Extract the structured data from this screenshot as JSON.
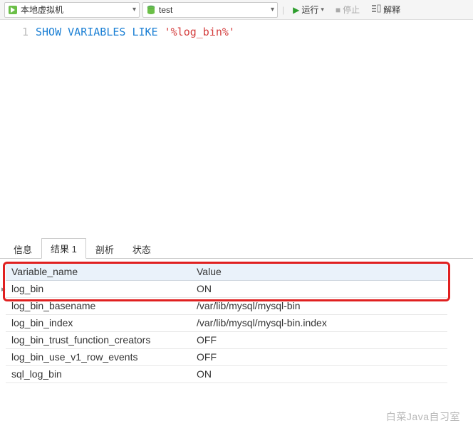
{
  "toolbar": {
    "connection": "本地虚拟机",
    "database": "test",
    "run": "运行",
    "stop": "停止",
    "explain": "解释"
  },
  "editor": {
    "line_no": "1",
    "sql_kw1": "SHOW",
    "sql_kw2": "VARIABLES",
    "sql_kw3": "LIKE",
    "sql_str": "'%log_bin%'"
  },
  "tabs": {
    "info": "信息",
    "result": "结果 1",
    "analyze": "剖析",
    "status": "状态"
  },
  "results": {
    "headers": {
      "col1": "Variable_name",
      "col2": "Value"
    },
    "rows": [
      {
        "name": "log_bin",
        "value": "ON"
      },
      {
        "name": "log_bin_basename",
        "value": "/var/lib/mysql/mysql-bin"
      },
      {
        "name": "log_bin_index",
        "value": "/var/lib/mysql/mysql-bin.index"
      },
      {
        "name": "log_bin_trust_function_creators",
        "value": "OFF"
      },
      {
        "name": "log_bin_use_v1_row_events",
        "value": "OFF"
      },
      {
        "name": "sql_log_bin",
        "value": "ON"
      }
    ]
  },
  "watermark": "白菜Java自习室"
}
